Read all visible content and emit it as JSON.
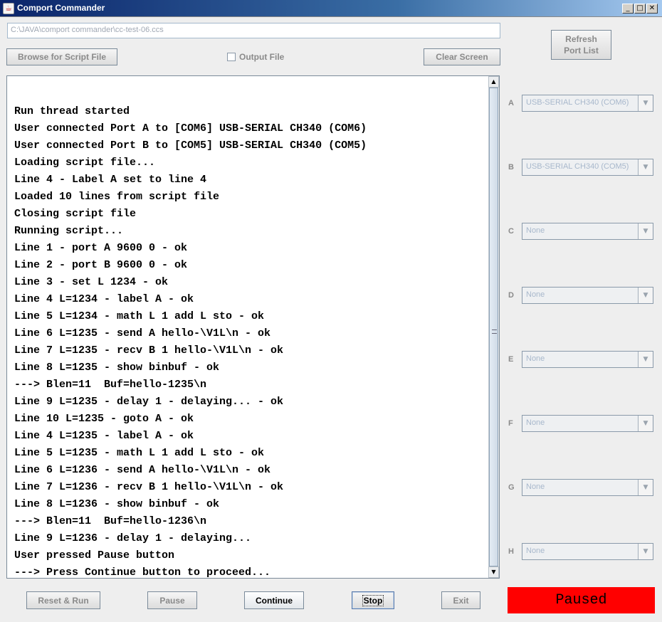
{
  "window": {
    "title": "Comport Commander",
    "icon": "java-icon",
    "minimize": "_",
    "maximize": "□",
    "close": "✕"
  },
  "script_path": "C:\\JAVA\\comport commander\\cc-test-06.ccs",
  "toolbar": {
    "browse_label": "Browse for Script File",
    "output_file_label": "Output File",
    "output_file_checked": false,
    "clear_label": "Clear Screen",
    "refresh_label_line1": "Refresh",
    "refresh_label_line2": "Port List"
  },
  "console_lines": [
    "Run thread started",
    "User connected Port A to [COM6] USB-SERIAL CH340 (COM6)",
    "User connected Port B to [COM5] USB-SERIAL CH340 (COM5)",
    "Loading script file...",
    "Line 4 - Label A set to line 4",
    "Loaded 10 lines from script file",
    "Closing script file",
    "Running script...",
    "Line 1 - port A 9600 0 - ok",
    "Line 2 - port B 9600 0 - ok",
    "Line 3 - set L 1234 - ok",
    "Line 4 L=1234 - label A - ok",
    "Line 5 L=1234 - math L 1 add L sto - ok",
    "Line 6 L=1235 - send A hello-\\V1L\\n - ok",
    "Line 7 L=1235 - recv B 1 hello-\\V1L\\n - ok",
    "Line 8 L=1235 - show binbuf - ok",
    "---> Blen=11  Buf=hello-1235\\n",
    "Line 9 L=1235 - delay 1 - delaying... - ok",
    "Line 10 L=1235 - goto A - ok",
    "Line 4 L=1235 - label A - ok",
    "Line 5 L=1235 - math L 1 add L sto - ok",
    "Line 6 L=1236 - send A hello-\\V1L\\n - ok",
    "Line 7 L=1236 - recv B 1 hello-\\V1L\\n - ok",
    "Line 8 L=1236 - show binbuf - ok",
    "---> Blen=11  Buf=hello-1236\\n",
    "Line 9 L=1236 - delay 1 - delaying...",
    "User pressed Pause button",
    "---> Press Continue button to proceed..."
  ],
  "ports": [
    {
      "label": "A",
      "value": "USB-SERIAL CH340 (COM6)"
    },
    {
      "label": "B",
      "value": "USB-SERIAL CH340 (COM5)"
    },
    {
      "label": "C",
      "value": "None"
    },
    {
      "label": "D",
      "value": "None"
    },
    {
      "label": "E",
      "value": "None"
    },
    {
      "label": "F",
      "value": "None"
    },
    {
      "label": "G",
      "value": "None"
    },
    {
      "label": "H",
      "value": "None"
    }
  ],
  "bottom_buttons": {
    "reset_run": "Reset & Run",
    "pause": "Pause",
    "continue": "Continue",
    "stop": "Stop",
    "exit": "Exit"
  },
  "status": {
    "text": "Paused",
    "color": "#ff0000"
  }
}
